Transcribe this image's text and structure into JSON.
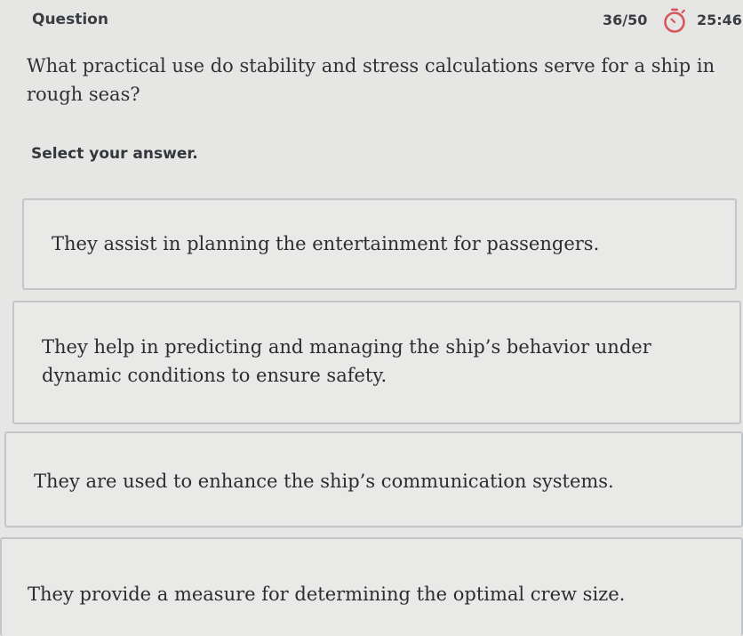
{
  "header": {
    "title": "Question",
    "progress": "36/50",
    "timer_icon": "stopwatch-icon",
    "timer": "25:46",
    "timer_icon_color": "#d6585f"
  },
  "question": {
    "text": "What practical use do stability and stress calculations serve for a ship in rough seas?"
  },
  "instruction": "Select your answer.",
  "options": [
    {
      "text": "They assist in planning the entertainment for passengers."
    },
    {
      "text": "They help in predicting and managing the ship’s behavior under dynamic conditions to ensure safety."
    },
    {
      "text": "They are used to enhance the ship’s communication systems."
    },
    {
      "text": "They provide a measure for determining the optimal crew size."
    }
  ]
}
